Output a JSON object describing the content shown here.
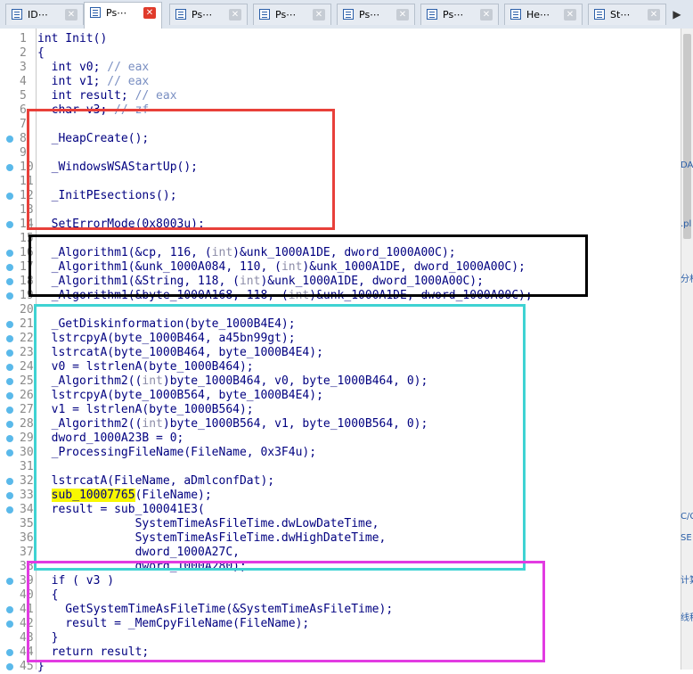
{
  "tabs": [
    {
      "label": "ID⋯",
      "active": false
    },
    {
      "label": "Ps⋯",
      "active": true
    },
    {
      "label": "Ps⋯",
      "active": false
    },
    {
      "label": "Ps⋯",
      "active": false
    },
    {
      "label": "Ps⋯",
      "active": false
    },
    {
      "label": "Ps⋯",
      "active": false
    },
    {
      "label": "He⋯",
      "active": false
    },
    {
      "label": "St⋯",
      "active": false
    }
  ],
  "code_lines": [
    {
      "n": "1",
      "dot": false,
      "t": "int Init()"
    },
    {
      "n": "2",
      "dot": false,
      "t": "{"
    },
    {
      "n": "3",
      "dot": false,
      "t": "  int v0; // eax"
    },
    {
      "n": "4",
      "dot": false,
      "t": "  int v1; // eax"
    },
    {
      "n": "5",
      "dot": false,
      "t": "  int result; // eax"
    },
    {
      "n": "6",
      "dot": false,
      "t": "  char v3; // zf"
    },
    {
      "n": "7",
      "dot": false,
      "t": ""
    },
    {
      "n": "8",
      "dot": true,
      "t": "  _HeapCreate();"
    },
    {
      "n": "9",
      "dot": false,
      "t": ""
    },
    {
      "n": "10",
      "dot": true,
      "t": "  _WindowsWSAStartUp();"
    },
    {
      "n": "11",
      "dot": false,
      "t": ""
    },
    {
      "n": "12",
      "dot": true,
      "t": "  _InitPEsections();"
    },
    {
      "n": "13",
      "dot": false,
      "t": ""
    },
    {
      "n": "14",
      "dot": true,
      "t": "  SetErrorMode(0x8003u);"
    },
    {
      "n": "15",
      "dot": false,
      "t": ""
    },
    {
      "n": "16",
      "dot": true,
      "t": "  _Algorithm1(&cp, 116, (int)&unk_1000A1DE, dword_1000A00C);"
    },
    {
      "n": "17",
      "dot": true,
      "t": "  _Algorithm1(&unk_1000A084, 110, (int)&unk_1000A1DE, dword_1000A00C);"
    },
    {
      "n": "18",
      "dot": true,
      "t": "  _Algorithm1(&String, 118, (int)&unk_1000A1DE, dword_1000A00C);"
    },
    {
      "n": "19",
      "dot": true,
      "t": "  _Algorithm1(&byte_1000A168, 118, (int)&unk_1000A1DE, dword_1000A00C);"
    },
    {
      "n": "20",
      "dot": false,
      "t": ""
    },
    {
      "n": "21",
      "dot": true,
      "t": "  _GetDiskinformation(byte_1000B4E4);"
    },
    {
      "n": "22",
      "dot": true,
      "t": "  lstrcpyA(byte_1000B464, a45bn99gt);"
    },
    {
      "n": "23",
      "dot": true,
      "t": "  lstrcatA(byte_1000B464, byte_1000B4E4);"
    },
    {
      "n": "24",
      "dot": true,
      "t": "  v0 = lstrlenA(byte_1000B464);"
    },
    {
      "n": "25",
      "dot": true,
      "t": "  _Algorithm2((int)byte_1000B464, v0, byte_1000B464, 0);"
    },
    {
      "n": "26",
      "dot": true,
      "t": "  lstrcpyA(byte_1000B564, byte_1000B4E4);"
    },
    {
      "n": "27",
      "dot": true,
      "t": "  v1 = lstrlenA(byte_1000B564);"
    },
    {
      "n": "28",
      "dot": true,
      "t": "  _Algorithm2((int)byte_1000B564, v1, byte_1000B564, 0);"
    },
    {
      "n": "29",
      "dot": true,
      "t": "  dword_1000A23B = 0;"
    },
    {
      "n": "30",
      "dot": true,
      "t": "  _ProcessingFileName(FileName, 0x3F4u);"
    },
    {
      "n": "31",
      "dot": false,
      "t": ""
    },
    {
      "n": "32",
      "dot": true,
      "t": "  lstrcatA(FileName, aDmlconfDat);"
    },
    {
      "n": "33",
      "dot": true,
      "t": "  sub_10007765(FileName);"
    },
    {
      "n": "34",
      "dot": true,
      "t": "  result = sub_100041E3("
    },
    {
      "n": "35",
      "dot": false,
      "t": "              SystemTimeAsFileTime.dwLowDateTime,"
    },
    {
      "n": "36",
      "dot": false,
      "t": "              SystemTimeAsFileTime.dwHighDateTime,"
    },
    {
      "n": "37",
      "dot": false,
      "t": "              dword_1000A27C,"
    },
    {
      "n": "38",
      "dot": false,
      "t": "              dword_1000A280);"
    },
    {
      "n": "39",
      "dot": true,
      "t": "  if ( v3 )"
    },
    {
      "n": "40",
      "dot": false,
      "t": "  {"
    },
    {
      "n": "41",
      "dot": true,
      "t": "    GetSystemTimeAsFileTime(&SystemTimeAsFileTime);"
    },
    {
      "n": "42",
      "dot": true,
      "t": "    result = _MemCpyFileName(FileName);"
    },
    {
      "n": "43",
      "dot": false,
      "t": "  }"
    },
    {
      "n": "44",
      "dot": true,
      "t": "  return result;"
    },
    {
      "n": "45",
      "dot": true,
      "t": "}"
    }
  ],
  "highlight_term": "sub_10007765",
  "side_fragments": [
    "DA",
    ".pl",
    "分析",
    "C/C",
    "SE",
    "计算",
    "线程"
  ],
  "colors": {
    "box_red": "#e8403a",
    "box_black": "#000000",
    "box_cyan": "#3fd3d3",
    "box_magenta": "#e23be2",
    "code": "#000080",
    "comment": "#7a8fc2",
    "highlight": "#f8f800",
    "bp_dot": "#5ab9ea"
  }
}
